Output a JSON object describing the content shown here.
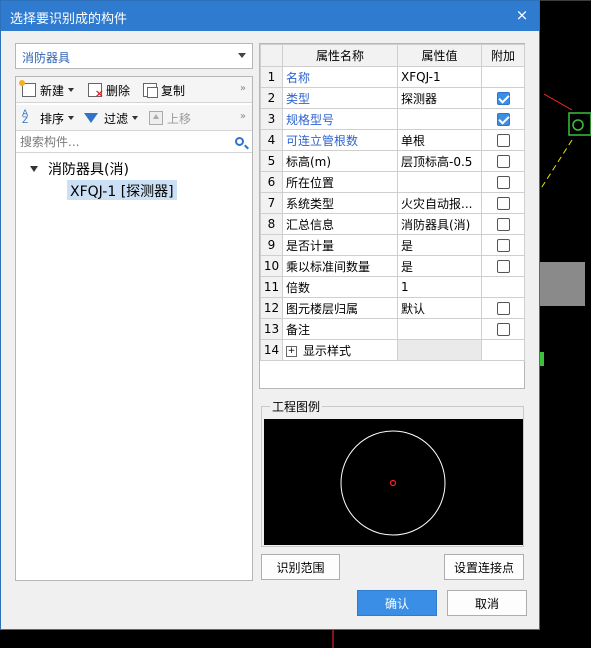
{
  "dialog": {
    "title": "选择要识别成的构件",
    "close_label": "×"
  },
  "left": {
    "category_select": "消防器具",
    "toolbar1": {
      "new_label": "新建",
      "delete_label": "删除",
      "copy_label": "复制",
      "more": "»"
    },
    "toolbar2": {
      "sort_label": "排序",
      "filter_label": "过滤",
      "move_up_label": "上移",
      "more": "»"
    },
    "search_placeholder": "搜索构件...",
    "tree": {
      "root_label": "消防器具(消)",
      "child_label": "XFQJ-1 [探测器]"
    }
  },
  "grid": {
    "headers": {
      "name": "属性名称",
      "value": "属性值",
      "extra": "附加"
    },
    "rows": [
      {
        "index": "1",
        "name": "名称",
        "value": "XFQJ-1"
      },
      {
        "index": "2",
        "name": "类型",
        "value": "探测器"
      },
      {
        "index": "3",
        "name": "规格型号",
        "value": ""
      },
      {
        "index": "4",
        "name": "可连立管根数",
        "value": "单根"
      },
      {
        "index": "5",
        "name": "标高(m)",
        "value": "层顶标高-0.5"
      },
      {
        "index": "6",
        "name": "所在位置",
        "value": ""
      },
      {
        "index": "7",
        "name": "系统类型",
        "value": "火灾自动报..."
      },
      {
        "index": "8",
        "name": "汇总信息",
        "value": "消防器具(消)"
      },
      {
        "index": "9",
        "name": "是否计量",
        "value": "是"
      },
      {
        "index": "10",
        "name": "乘以标准间数量",
        "value": "是"
      },
      {
        "index": "11",
        "name": "倍数",
        "value": "1"
      },
      {
        "index": "12",
        "name": "图元楼层归属",
        "value": "默认"
      },
      {
        "index": "13",
        "name": "备注",
        "value": ""
      },
      {
        "index": "14",
        "name": "显示样式",
        "value": ""
      }
    ]
  },
  "legend": {
    "caption": "工程图例"
  },
  "buttons": {
    "identify_range": "识别范围",
    "set_connection": "设置连接点",
    "ok": "确认",
    "cancel": "取消"
  },
  "colors": {
    "title_bar": "#2e7bd0",
    "link_blue": "#2f63d0",
    "checkbox_on": "#3b8ee6"
  }
}
